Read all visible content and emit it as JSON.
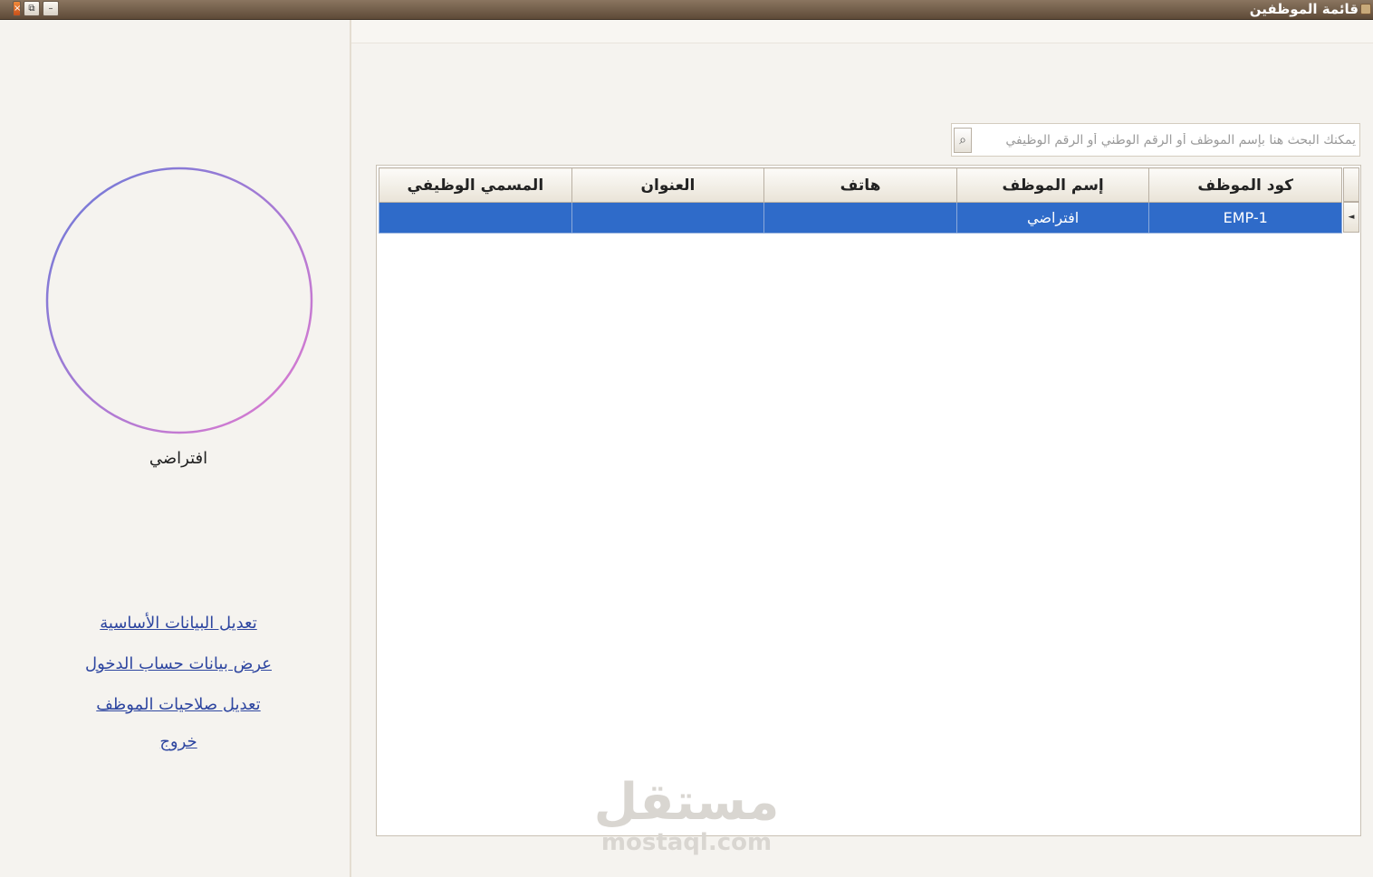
{
  "window": {
    "title": "قائمة الموظفين",
    "buttons": {
      "minimize": "–",
      "restore": "⧉",
      "close": "×"
    }
  },
  "sidebar": {
    "user_name": "افتراضي",
    "links": [
      "تعديل البيانات الأساسية",
      "عرض بيانات حساب الدخول",
      "تعديل صلاحيات الموظف",
      "خروج"
    ]
  },
  "search": {
    "placeholder": "يمكنك البحث هنا بإسم الموظف أو الرقم الوطني أو الرقم الوظيفي",
    "value": ""
  },
  "table": {
    "columns": [
      "كود الموظف",
      "إسم الموظف",
      "هاتف",
      "العنوان",
      "المسمي الوظيفي"
    ],
    "rows": [
      [
        "EMP-1",
        "افتراضي",
        "",
        "",
        ""
      ]
    ],
    "row_marker": "◄"
  },
  "watermark": {
    "arabic": "مستقل",
    "latin": "mostaql.com"
  },
  "colors": {
    "selection": "#2f6bc9",
    "link": "#2e46a0",
    "avatar_ring_start": "#6d7ad8",
    "avatar_ring_end": "#e07ad0"
  }
}
